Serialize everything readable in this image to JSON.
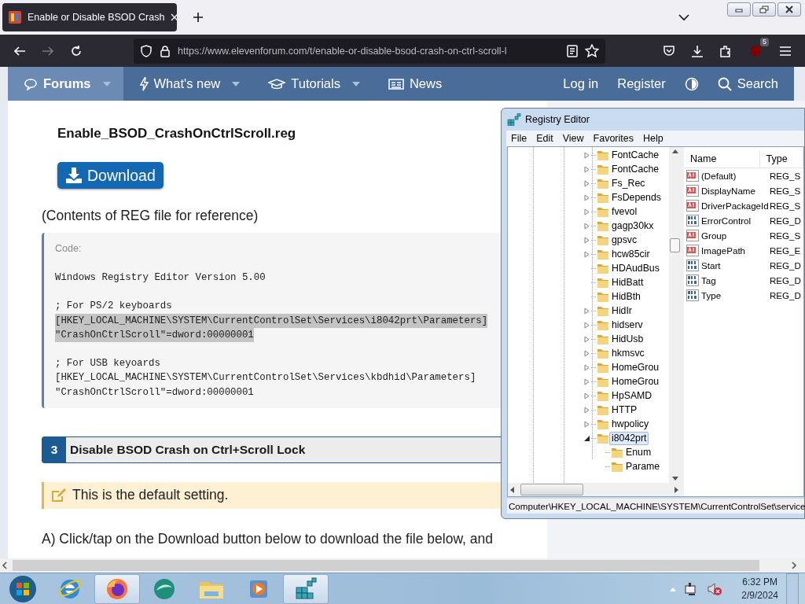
{
  "browser": {
    "tab_title": "Enable or Disable BSOD Crash",
    "url": "https://www.elevenforum.com/t/enable-or-disable-bsod-crash-on-ctrl-scroll-l",
    "extension_badge": "5"
  },
  "forum_nav": {
    "items": [
      {
        "label": "Forums",
        "selected": true,
        "dropdown": true
      },
      {
        "label": "What's new",
        "selected": false,
        "dropdown": true
      },
      {
        "label": "Tutorials",
        "selected": false,
        "dropdown": true
      },
      {
        "label": "News",
        "selected": false,
        "dropdown": false
      }
    ],
    "login": "Log in",
    "register": "Register",
    "search": "Search"
  },
  "article": {
    "filename": "Enable_BSOD_CrashOnCtrlScroll.reg",
    "download": "Download",
    "contents_note": "(Contents of REG file for reference)",
    "code": {
      "label": "Code:",
      "blocks": [
        {
          "lines": [
            {
              "text": "Windows Registry Editor Version 5.00",
              "highlighted": false
            }
          ]
        },
        {
          "lines": [
            {
              "text": "; For PS/2 keyboards",
              "highlighted": false
            },
            {
              "text": "[HKEY_LOCAL_MACHINE\\SYSTEM\\CurrentControlSet\\Services\\i8042prt\\Parameters]",
              "highlighted": true
            },
            {
              "text": "\"CrashOnCtrlScroll\"=dword:00000001",
              "highlighted": true
            }
          ]
        },
        {
          "lines": [
            {
              "text": "; For USB keyoards",
              "highlighted": false
            },
            {
              "text": "[HKEY_LOCAL_MACHINE\\SYSTEM\\CurrentControlSet\\Services\\kbdhid\\Parameters]",
              "highlighted": false
            },
            {
              "text": "\"CrashOnCtrlScroll\"=dword:00000001",
              "highlighted": false
            }
          ]
        }
      ]
    },
    "step": {
      "number": "3",
      "title": "Disable BSOD Crash on Ctrl+Scroll Lock"
    },
    "note": "This is the default setting.",
    "paragraph": "A) Click/tap on the Download button below to download the file below, and"
  },
  "regedit": {
    "title": "Registry Editor",
    "menu": [
      "File",
      "Edit",
      "View",
      "Favorites",
      "Help"
    ],
    "tree": [
      {
        "label": "FontCache",
        "expandable": true,
        "expanded": false,
        "selected": false
      },
      {
        "label": "FontCache",
        "expandable": true,
        "expanded": false,
        "selected": false
      },
      {
        "label": "Fs_Rec",
        "expandable": true,
        "expanded": false,
        "selected": false
      },
      {
        "label": "FsDepends",
        "expandable": true,
        "expanded": false,
        "selected": false
      },
      {
        "label": "fvevol",
        "expandable": true,
        "expanded": false,
        "selected": false
      },
      {
        "label": "gagp30kx",
        "expandable": true,
        "expanded": false,
        "selected": false
      },
      {
        "label": "gpsvc",
        "expandable": true,
        "expanded": false,
        "selected": false
      },
      {
        "label": "hcw85cir",
        "expandable": true,
        "expanded": false,
        "selected": false
      },
      {
        "label": "HDAudBus",
        "expandable": false,
        "selected": false
      },
      {
        "label": "HidBatt",
        "expandable": false,
        "selected": false
      },
      {
        "label": "HidBth",
        "expandable": false,
        "selected": false
      },
      {
        "label": "HidIr",
        "expandable": true,
        "expanded": false,
        "selected": false
      },
      {
        "label": "hidserv",
        "expandable": true,
        "expanded": false,
        "selected": false
      },
      {
        "label": "HidUsb",
        "expandable": true,
        "expanded": false,
        "selected": false
      },
      {
        "label": "hkmsvc",
        "expandable": true,
        "expanded": false,
        "selected": false
      },
      {
        "label": "HomeGrou",
        "expandable": true,
        "expanded": false,
        "selected": false
      },
      {
        "label": "HomeGrou",
        "expandable": true,
        "expanded": false,
        "selected": false
      },
      {
        "label": "HpSAMD",
        "expandable": true,
        "expanded": false,
        "selected": false
      },
      {
        "label": "HTTP",
        "expandable": true,
        "expanded": false,
        "selected": false
      },
      {
        "label": "hwpolicy",
        "expandable": true,
        "expanded": false,
        "selected": false
      },
      {
        "label": "i8042prt",
        "expandable": true,
        "expanded": true,
        "selected": true,
        "children": [
          {
            "label": "Enum",
            "expandable": false,
            "selected": false
          },
          {
            "label": "Parame",
            "expandable": false,
            "selected": false
          }
        ]
      }
    ],
    "columns": [
      "Name",
      "Type"
    ],
    "values": [
      {
        "name": "(Default)",
        "type": "REG_S",
        "kind": "string"
      },
      {
        "name": "DisplayName",
        "type": "REG_S",
        "kind": "string"
      },
      {
        "name": "DriverPackageId",
        "type": "REG_S",
        "kind": "string"
      },
      {
        "name": "ErrorControl",
        "type": "REG_D",
        "kind": "dword"
      },
      {
        "name": "Group",
        "type": "REG_S",
        "kind": "string"
      },
      {
        "name": "ImagePath",
        "type": "REG_E",
        "kind": "string"
      },
      {
        "name": "Start",
        "type": "REG_D",
        "kind": "dword"
      },
      {
        "name": "Tag",
        "type": "REG_D",
        "kind": "dword"
      },
      {
        "name": "Type",
        "type": "REG_D",
        "kind": "dword"
      }
    ],
    "status": "Computer\\HKEY_LOCAL_MACHINE\\SYSTEM\\CurrentControlSet\\service"
  },
  "taskbar": {
    "apps": [
      {
        "selected": false
      },
      {
        "selected": true
      },
      {
        "selected": false
      },
      {
        "selected": false
      },
      {
        "selected": false
      },
      {
        "selected": true
      }
    ],
    "time": "6:32 PM",
    "date": "2/9/2024"
  }
}
